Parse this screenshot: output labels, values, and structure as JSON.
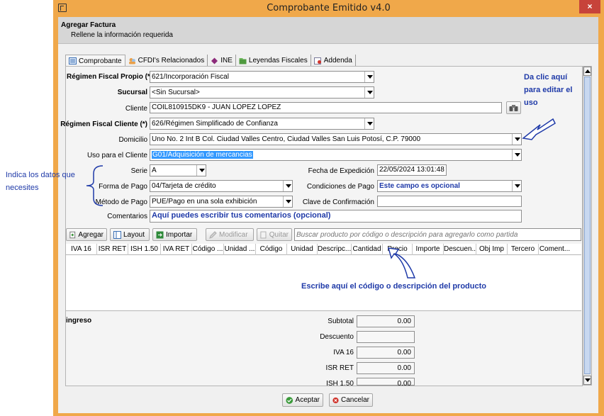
{
  "window": {
    "title": "Comprobante Emitido v4.0",
    "close_label": "×",
    "heading": "Agregar Factura",
    "subheading": "Rellene la información requerida"
  },
  "tabs": [
    {
      "label": "Comprobante",
      "icon": "document-icon"
    },
    {
      "label": "CFDI's Relacionados",
      "icon": "people-icon"
    },
    {
      "label": "INE",
      "icon": "diamond-icon"
    },
    {
      "label": "Leyendas Fiscales",
      "icon": "folder-icon"
    },
    {
      "label": "Addenda",
      "icon": "addenda-icon"
    }
  ],
  "form": {
    "regimen_propio_label": "Régimen Fiscal Propio (*)",
    "regimen_propio_value": "621/Incorporación Fiscal",
    "sucursal_label": "Sucursal",
    "sucursal_value": "<Sin Sucursal>",
    "cliente_label": "Cliente",
    "cliente_value": "COIL810915DK9 - JUAN LOPEZ LOPEZ",
    "regimen_cliente_label": "Régimen Fiscal Cliente (*)",
    "regimen_cliente_value": "626/Régimen Simplificado de Confianza",
    "domicilio_label": "Domicilio",
    "domicilio_value": "Uno No. 2 Int B Col. Ciudad Valles Centro, Ciudad Valles San Luis Potosí, C.P. 79000",
    "uso_label": "Uso para el Cliente",
    "uso_value": "G01/Adquisición de mercancias",
    "serie_label": "Serie",
    "serie_value": "A",
    "forma_label": "Forma de Pago",
    "forma_value": "04/Tarjeta de crédito",
    "metodo_label": "Método de Pago",
    "metodo_value": "PUE/Pago en una sola exhibición",
    "fecha_label": "Fecha de Expedición",
    "fecha_value": "22/05/2024 13:01:48",
    "condiciones_label": "Condiciones de Pago",
    "condiciones_value": "Este campo es opcional",
    "clave_label": "Clave de Confirmación",
    "clave_value": "",
    "comentarios_label": "Comentarios",
    "comentarios_value": "Aquí puedes escribir tus comentarios (opcional)"
  },
  "toolbar": {
    "agregar": "Agregar",
    "layout": "Layout",
    "importar": "Importar",
    "modificar": "Modificar",
    "quitar": "Quitar",
    "search_placeholder": "Buscar producto por código o descripción para agregarlo como partida"
  },
  "grid_columns": [
    "IVA 16",
    "ISR RET",
    "ISH 1.50",
    "IVA RET",
    "Código ...",
    "Unidad ...",
    "Código",
    "Unidad",
    "Descripc...",
    "Cantidad",
    "Precio",
    "Importe",
    "Descuen...",
    "Obj Imp",
    "Tercero",
    "Coment..."
  ],
  "totals": {
    "type_label": "ingreso",
    "rows": [
      {
        "label": "Subtotal",
        "value": "0.00"
      },
      {
        "label": "Descuento",
        "value": ""
      },
      {
        "label": "IVA 16",
        "value": "0.00"
      },
      {
        "label": "ISR RET",
        "value": "0.00"
      },
      {
        "label": "ISH 1.50",
        "value": "0.00"
      }
    ]
  },
  "footer": {
    "aceptar": "Aceptar",
    "cancelar": "Cancelar"
  },
  "annotations": {
    "edit_note_line1": "Da clic aquí",
    "edit_note_line2": "para editar el",
    "edit_note_line3": "uso",
    "data_note_line1": "Indica los datos que",
    "data_note_line2": "necesites",
    "search_note": "Escribe aquí el código o descripción del producto"
  },
  "colors": {
    "frame": "#f0a84a",
    "close": "#c7433a",
    "note_text": "#1f3aa8",
    "selection": "#3399ff"
  }
}
